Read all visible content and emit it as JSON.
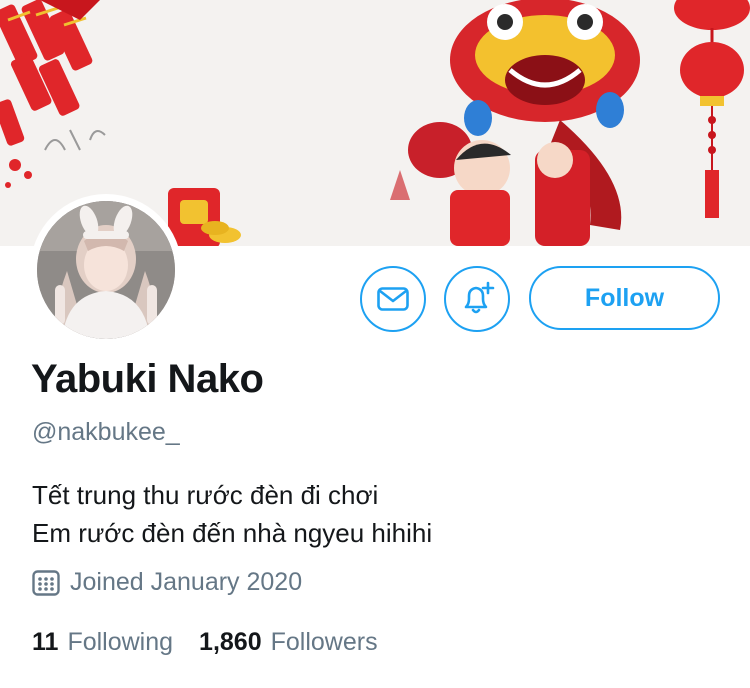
{
  "profile": {
    "display_name": "Yabuki Nako",
    "handle": "@nakbukee_",
    "bio_lines": [
      "Tết trung thu rước đèn đi chơi",
      "Em rước đèn đến nhà ngyeu hihihi"
    ],
    "joined": "Joined January 2020"
  },
  "actions": {
    "follow_label": "Follow",
    "message_icon": "envelope-icon",
    "notify_icon": "bell-plus-icon"
  },
  "stats": {
    "following_count": "11",
    "following_label": "Following",
    "followers_count": "1,860",
    "followers_label": "Followers"
  },
  "colors": {
    "accent": "#1da1f2",
    "secondary_text": "#657786",
    "primary_text": "#14171a"
  }
}
